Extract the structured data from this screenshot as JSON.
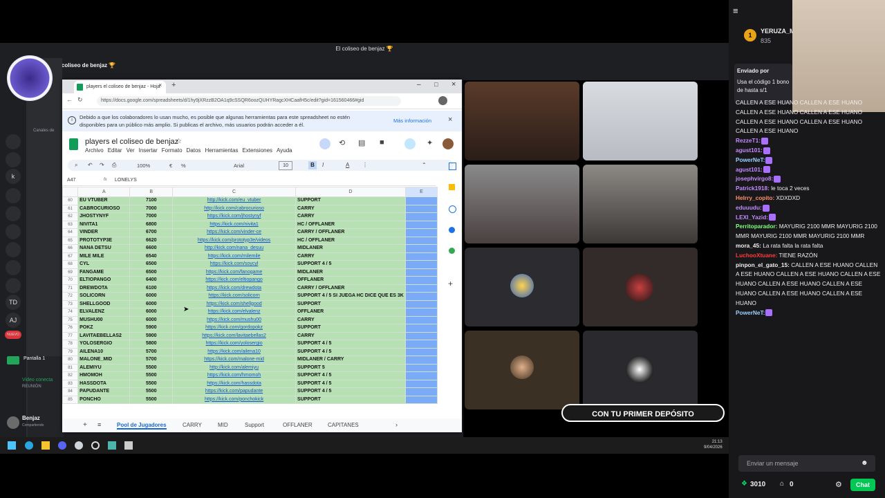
{
  "stream": {
    "window_title": "El coliseo de benjaz 🏆",
    "server_name": "el coliseo de benjaz 🏆",
    "promo_text": "CON TU PRIMER DEPÓSITO"
  },
  "discord": {
    "server_badges": [
      "k",
      "TD",
      "AJ",
      "NUEVO"
    ],
    "channels_label": "Canales de",
    "voice_labels": [
      "Pantalla 1",
      "Video conecta",
      "REUNIÓN"
    ],
    "user": "Benjaz",
    "user_status": "Compartiendo"
  },
  "browser": {
    "tab_title": "players el coliseo de benjaz - Hoja",
    "url": "https://docs.google.com/spreadsheets/d/1hy9jXRzzB2OA1q9cSSQR6oozQUHYRagcXHCaafH5c/edit?gid=161560466#gid",
    "notice": "Debido a que los colaboradores lo usan mucho, es posible que algunas herramientas para este spreadsheet no estén disponibles para un público más amplio. Si publicas el archivo, más usuarios podrán acceder a él.",
    "notice_more": "Más información"
  },
  "sheet": {
    "title": "players el coliseo de benjaz",
    "menu": [
      "Archivo",
      "Editar",
      "Ver",
      "Insertar",
      "Formato",
      "Datos",
      "Herramientas",
      "Extensiones",
      "Ayuda"
    ],
    "zoom": "100%",
    "font": "Arial",
    "font_size": "10",
    "cell_ref": "A47",
    "formula_value": "LONELYS",
    "col_headers": [
      "A",
      "B",
      "C",
      "D",
      "E"
    ],
    "rows": [
      {
        "n": "60",
        "name": "EU VTUBER",
        "mmr": "7100",
        "link": "http://kick.com/eu_vtuber",
        "role": "SUPPORT"
      },
      {
        "n": "61",
        "name": "CABROCURIOSO",
        "mmr": "7000",
        "link": "http://kick.com/cabrocurioso",
        "role": "CARRY"
      },
      {
        "n": "62",
        "name": "JHOSTYNYF",
        "mmr": "7000",
        "link": "https://kick.com/jhostynyf",
        "role": "CARRY"
      },
      {
        "n": "63",
        "name": "NIVITA1",
        "mmr": "6800",
        "link": "https://kick.com/nivita1",
        "role": "HC / OFFLANER"
      },
      {
        "n": "64",
        "name": "VINDER",
        "mmr": "6700",
        "link": "https://kick.com/vinder-ce",
        "role": "CARRY / OFFLANER"
      },
      {
        "n": "65",
        "name": "PROTOTYP3E",
        "mmr": "6620",
        "link": "https://kick.com/prototyp3e/videos",
        "role": "HC / OFFLANER"
      },
      {
        "n": "66",
        "name": "NANA DETSU",
        "mmr": "6600",
        "link": "http://kick.com/nana_desuu",
        "role": "MIDLANER"
      },
      {
        "n": "67",
        "name": "MILE MILE",
        "mmr": "6540",
        "link": "https://kick.com/milemile",
        "role": "CARRY"
      },
      {
        "n": "68",
        "name": "CYL",
        "mmr": "6500",
        "link": "https://kick.com/soycyl",
        "role": "SUPPORT 4 / 5"
      },
      {
        "n": "69",
        "name": "FANGAME",
        "mmr": "6500",
        "link": "https://kick.com/fanogame",
        "role": "MIDLANER"
      },
      {
        "n": "70",
        "name": "ELTIOPANGO",
        "mmr": "6400",
        "link": "https://kick.com/eltiopango",
        "role": "OFFLANER"
      },
      {
        "n": "71",
        "name": "DREWDOTA",
        "mmr": "6100",
        "link": "https://kick.com/drewdota",
        "role": "CARRY / OFFLANER"
      },
      {
        "n": "72",
        "name": "SOLICORN",
        "mmr": "6000",
        "link": "https://kick.com/solicorn",
        "role": "SUPPORT 4 / 5 SI JUEGA HC DICE QUE ES 3K"
      },
      {
        "n": "73",
        "name": "SHELLGOOD",
        "mmr": "6000",
        "link": "https://kick.com/shellgood",
        "role": "SUPPORT"
      },
      {
        "n": "74",
        "name": "ELVALENZ",
        "mmr": "6000",
        "link": "https://kick.com/elvalenz",
        "role": "OFFLANER"
      },
      {
        "n": "75",
        "name": "MUSHU00",
        "mmr": "6000",
        "link": "https://kick.com/mushu00",
        "role": "CARRY"
      },
      {
        "n": "76",
        "name": "POKZ",
        "mmr": "5900",
        "link": "https://kick.com/gordopokz",
        "role": "SUPPORT"
      },
      {
        "n": "77",
        "name": "LAVITAEBELLAS2",
        "mmr": "5900",
        "link": "https://kick.com/lavitaebellas2",
        "role": "CARRY"
      },
      {
        "n": "78",
        "name": "YOLOSERGIO",
        "mmr": "5800",
        "link": "https://kick.com/yolosergio",
        "role": "SUPPORT 4 / 5"
      },
      {
        "n": "79",
        "name": "AILENA10",
        "mmr": "5700",
        "link": "https://kick.com/ailena10",
        "role": "SUPPORT 4 / 5"
      },
      {
        "n": "80",
        "name": "MALONE_MID",
        "mmr": "5700",
        "link": "https://kick.com/malone-mid",
        "role": "MIDLANER / CARRY"
      },
      {
        "n": "81",
        "name": "ALEMIYU",
        "mmr": "5500",
        "link": "http://kick.com/alemiyu",
        "role": "SUPPORT 5"
      },
      {
        "n": "82",
        "name": "HMOMOH",
        "mmr": "5500",
        "link": "https://kick.com/hmomoh",
        "role": "SUPPORT 4 / 5"
      },
      {
        "n": "83",
        "name": "HASSDOTA",
        "mmr": "5500",
        "link": "https://kick.com/hassdota",
        "role": "SUPPORT 4 / 5"
      },
      {
        "n": "84",
        "name": "PAPUDANTE",
        "mmr": "5500",
        "link": "https://kick.com/papudante",
        "role": "SUPPORT 4 / 5"
      },
      {
        "n": "85",
        "name": "PONCHO",
        "mmr": "5500",
        "link": "https://kick.com/ponchokick",
        "role": "SUPPORT"
      }
    ],
    "tabs": [
      "Pool de Jugadores",
      "CARRY",
      "MID",
      "Support",
      "OFFLANER",
      "CAPITANES"
    ]
  },
  "taskbar": {
    "time": "21:13",
    "date": "9/04/2026"
  },
  "chat": {
    "sub_user": "YERUZA_M",
    "sub_count": "835",
    "banner_from": "Enviado por",
    "banner_text": "Usa el código 1 bono de hasta s/1",
    "messages": [
      {
        "user": "",
        "text": "CALLEN A ESE HUANO CALLEN A ESE HUANO CALLEN A ESE HUANO CALLEN A ESE HUANO CALLEN A ESE HUANO CALLEN A ESE HUANO CALLEN A ESE HUANO",
        "color": "#efeff1"
      },
      {
        "user": "RezzeT1:",
        "text": "",
        "color": "#c38bff"
      },
      {
        "user": "agust101:",
        "text": "",
        "color": "#c38bff"
      },
      {
        "user": "PowerNeT:",
        "text": "",
        "color": "#9ad0ff"
      },
      {
        "user": "agust101:",
        "text": "",
        "color": "#c38bff"
      },
      {
        "user": "josephvirgo8:",
        "text": "",
        "color": "#c38bff"
      },
      {
        "user": "Patrick1918:",
        "text": " le toca 2 veces",
        "color": "#c38bff"
      },
      {
        "user": "Helrry_copito:",
        "text": " XDXDXD",
        "color": "#ff8f6b"
      },
      {
        "user": "eduuudu:",
        "text": "",
        "color": "#c38bff"
      },
      {
        "user": "LEXI_Yazid:",
        "text": "",
        "color": "#c38bff"
      },
      {
        "user": "Perritoparador:",
        "text": " MAYURIG 2100 MMR MAYURIG 2100 MMR MAYURIG 2100 MMR MAYURIG 2100 MMR",
        "color": "#7fff7f"
      },
      {
        "user": "mora_45:",
        "text": " La rata falta la rata falta",
        "color": "#efeff1"
      },
      {
        "user": "LuchooXtuane:",
        "text": " TIENE RAZÓN",
        "color": "#ff3b3b"
      },
      {
        "user": "pinpon_el_gato_15:",
        "text": " CALLEN A ESE HUANO CALLEN A ESE HUANO CALLEN A ESE HUANO CALLEN A ESE HUANO CALLEN A ESE HUANO CALLEN A ESE HUANO CALLEN A ESE HUANO CALLEN A ESE HUANO",
        "color": "#efeff1"
      },
      {
        "user": "PowerNeT:",
        "text": "",
        "color": "#9ad0ff"
      }
    ],
    "input_placeholder": "Enviar un mensaje",
    "points": "3010",
    "second_count": "0",
    "send_label": "Chat"
  }
}
